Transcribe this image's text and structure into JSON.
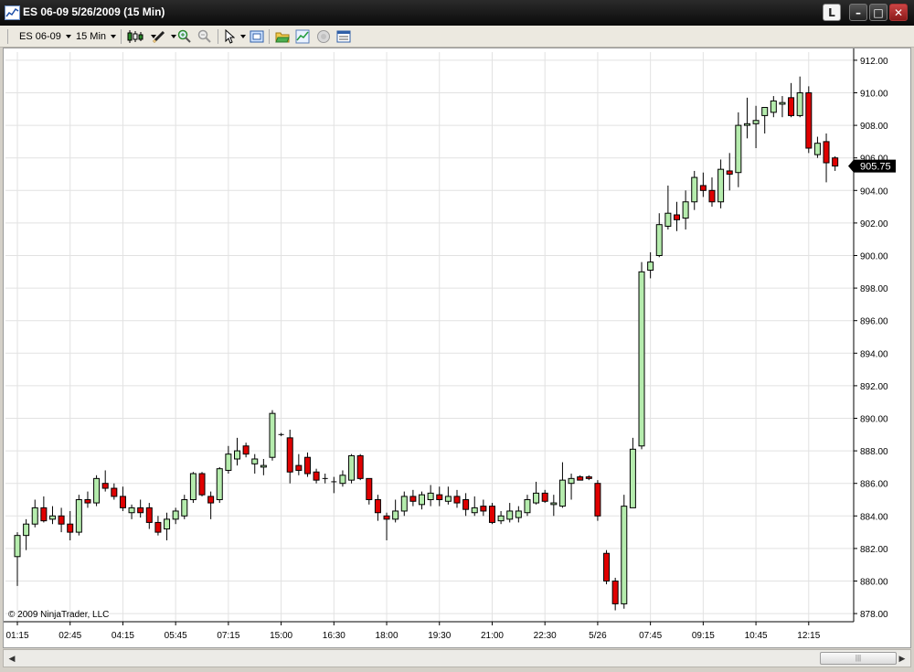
{
  "window": {
    "title": "ES 06-09  5/26/2009 (15 Min)",
    "layout_button": "L",
    "min_glyph": "–",
    "max_glyph": "□",
    "close_glyph": "✕"
  },
  "toolbar": {
    "instrument": "ES 06-09",
    "interval": "15 Min",
    "icons": [
      "candlestick-style-icon",
      "pencil-draw-icon",
      "zoom-in-icon",
      "zoom-out-icon",
      "cursor-icon",
      "snapshot-icon",
      "folder-icon",
      "chart-properties-icon",
      "globe-icon",
      "data-box-icon"
    ]
  },
  "chart": {
    "copyright": "© 2009 NinjaTrader, LLC",
    "last_price_label": "905.75"
  },
  "scrollbar": {
    "left_arrow": "◀",
    "right_arrow": "▶",
    "thumb_grip": "|||"
  },
  "colors": {
    "up": "#b5ecad",
    "down": "#e00000",
    "grid": "#e2e2e2",
    "background": "#ffffff",
    "price_marker": "#000000"
  },
  "chart_data": {
    "type": "candlestick",
    "title": "",
    "xlabel": "",
    "ylabel": "",
    "ylim": [
      877.5,
      912.5
    ],
    "yticks": [
      "912.00",
      "910.00",
      "908.00",
      "906.00",
      "904.00",
      "902.00",
      "900.00",
      "898.00",
      "896.00",
      "894.00",
      "892.00",
      "890.00",
      "888.00",
      "886.00",
      "884.00",
      "882.00",
      "880.00",
      "878.00"
    ],
    "x_tick_labels": [
      "01:15",
      "02:45",
      "04:15",
      "05:45",
      "07:15",
      "15:00",
      "16:30",
      "18:00",
      "19:30",
      "21:00",
      "22:30",
      "5/26",
      "07:45",
      "09:15",
      "10:45",
      "12:15"
    ],
    "grid": true,
    "candles": [
      {
        "o": 881.5,
        "h": 883.0,
        "l": 879.7,
        "c": 882.8
      },
      {
        "o": 882.8,
        "h": 883.8,
        "l": 881.9,
        "c": 883.5
      },
      {
        "o": 883.5,
        "h": 885.0,
        "l": 883.3,
        "c": 884.5
      },
      {
        "o": 884.5,
        "h": 885.2,
        "l": 883.6,
        "c": 883.7
      },
      {
        "o": 883.8,
        "h": 884.6,
        "l": 883.5,
        "c": 884.0
      },
      {
        "o": 884.0,
        "h": 884.5,
        "l": 883.0,
        "c": 883.5
      },
      {
        "o": 883.5,
        "h": 884.3,
        "l": 882.5,
        "c": 883.0
      },
      {
        "o": 883.0,
        "h": 885.3,
        "l": 882.8,
        "c": 885.0
      },
      {
        "o": 885.0,
        "h": 885.5,
        "l": 884.5,
        "c": 884.8
      },
      {
        "o": 884.8,
        "h": 886.5,
        "l": 884.6,
        "c": 886.3
      },
      {
        "o": 886.0,
        "h": 886.8,
        "l": 885.5,
        "c": 885.7
      },
      {
        "o": 885.7,
        "h": 886.0,
        "l": 885.0,
        "c": 885.2
      },
      {
        "o": 885.2,
        "h": 885.8,
        "l": 884.3,
        "c": 884.5
      },
      {
        "o": 884.2,
        "h": 884.7,
        "l": 883.8,
        "c": 884.5
      },
      {
        "o": 884.5,
        "h": 885.0,
        "l": 883.9,
        "c": 884.2
      },
      {
        "o": 884.5,
        "h": 884.8,
        "l": 883.2,
        "c": 883.6
      },
      {
        "o": 883.6,
        "h": 884.0,
        "l": 882.8,
        "c": 883.0
      },
      {
        "o": 883.2,
        "h": 884.2,
        "l": 882.5,
        "c": 883.8
      },
      {
        "o": 883.8,
        "h": 884.5,
        "l": 883.5,
        "c": 884.3
      },
      {
        "o": 884.0,
        "h": 885.3,
        "l": 883.8,
        "c": 885.0
      },
      {
        "o": 885.0,
        "h": 886.7,
        "l": 884.8,
        "c": 886.6
      },
      {
        "o": 886.6,
        "h": 886.7,
        "l": 885.2,
        "c": 885.3
      },
      {
        "o": 885.2,
        "h": 885.5,
        "l": 883.8,
        "c": 884.8
      },
      {
        "o": 885.0,
        "h": 887.0,
        "l": 884.8,
        "c": 886.9
      },
      {
        "o": 886.8,
        "h": 888.3,
        "l": 886.6,
        "c": 887.8
      },
      {
        "o": 887.5,
        "h": 888.8,
        "l": 887.1,
        "c": 888.0
      },
      {
        "o": 888.3,
        "h": 888.5,
        "l": 887.6,
        "c": 887.8
      },
      {
        "o": 887.2,
        "h": 887.8,
        "l": 886.6,
        "c": 887.5
      },
      {
        "o": 887.0,
        "h": 887.5,
        "l": 886.5,
        "c": 887.1
      },
      {
        "o": 887.6,
        "h": 890.5,
        "l": 887.4,
        "c": 890.3
      },
      {
        "o": 889.0,
        "h": 889.1,
        "l": 888.9,
        "c": 889.0
      },
      {
        "o": 888.8,
        "h": 889.3,
        "l": 886.0,
        "c": 886.7
      },
      {
        "o": 887.1,
        "h": 887.8,
        "l": 886.5,
        "c": 886.8
      },
      {
        "o": 887.6,
        "h": 887.9,
        "l": 886.4,
        "c": 886.6
      },
      {
        "o": 886.7,
        "h": 886.9,
        "l": 886.0,
        "c": 886.2
      },
      {
        "o": 886.3,
        "h": 886.6,
        "l": 886.0,
        "c": 886.3
      },
      {
        "o": 886.1,
        "h": 886.4,
        "l": 885.4,
        "c": 886.1
      },
      {
        "o": 886.0,
        "h": 886.8,
        "l": 885.8,
        "c": 886.5
      },
      {
        "o": 886.2,
        "h": 887.8,
        "l": 886.0,
        "c": 887.7
      },
      {
        "o": 887.7,
        "h": 887.8,
        "l": 886.2,
        "c": 886.3
      },
      {
        "o": 886.3,
        "h": 886.3,
        "l": 884.7,
        "c": 885.0
      },
      {
        "o": 885.0,
        "h": 885.3,
        "l": 883.7,
        "c": 884.2
      },
      {
        "o": 884.0,
        "h": 884.2,
        "l": 882.5,
        "c": 883.8
      },
      {
        "o": 883.8,
        "h": 885.0,
        "l": 883.6,
        "c": 884.3
      },
      {
        "o": 884.3,
        "h": 885.5,
        "l": 884.0,
        "c": 885.2
      },
      {
        "o": 885.2,
        "h": 885.6,
        "l": 884.6,
        "c": 884.9
      },
      {
        "o": 884.7,
        "h": 885.5,
        "l": 884.4,
        "c": 885.3
      },
      {
        "o": 885.0,
        "h": 885.9,
        "l": 884.6,
        "c": 885.4
      },
      {
        "o": 885.3,
        "h": 885.8,
        "l": 884.6,
        "c": 885.0
      },
      {
        "o": 884.9,
        "h": 885.8,
        "l": 884.7,
        "c": 885.2
      },
      {
        "o": 885.2,
        "h": 885.6,
        "l": 884.5,
        "c": 884.8
      },
      {
        "o": 885.0,
        "h": 885.4,
        "l": 884.0,
        "c": 884.4
      },
      {
        "o": 884.2,
        "h": 885.2,
        "l": 884.0,
        "c": 884.5
      },
      {
        "o": 884.6,
        "h": 885.0,
        "l": 884.0,
        "c": 884.3
      },
      {
        "o": 884.6,
        "h": 884.8,
        "l": 883.5,
        "c": 883.6
      },
      {
        "o": 883.7,
        "h": 884.3,
        "l": 883.5,
        "c": 884.0
      },
      {
        "o": 883.8,
        "h": 884.8,
        "l": 883.6,
        "c": 884.3
      },
      {
        "o": 883.9,
        "h": 884.6,
        "l": 883.6,
        "c": 884.3
      },
      {
        "o": 884.2,
        "h": 885.3,
        "l": 884.0,
        "c": 885.0
      },
      {
        "o": 884.8,
        "h": 886.1,
        "l": 884.7,
        "c": 885.4
      },
      {
        "o": 885.4,
        "h": 885.6,
        "l": 884.8,
        "c": 884.9
      },
      {
        "o": 884.7,
        "h": 885.3,
        "l": 884.0,
        "c": 884.8
      },
      {
        "o": 884.6,
        "h": 887.3,
        "l": 884.5,
        "c": 886.2
      },
      {
        "o": 886.0,
        "h": 886.6,
        "l": 885.0,
        "c": 886.3
      },
      {
        "o": 886.4,
        "h": 886.5,
        "l": 886.2,
        "c": 886.2
      },
      {
        "o": 886.4,
        "h": 886.5,
        "l": 886.2,
        "c": 886.3
      },
      {
        "o": 886.0,
        "h": 886.2,
        "l": 883.7,
        "c": 884.0
      },
      {
        "o": 881.7,
        "h": 881.9,
        "l": 879.8,
        "c": 880.0
      },
      {
        "o": 880.0,
        "h": 880.2,
        "l": 878.2,
        "c": 878.6
      },
      {
        "o": 878.6,
        "h": 885.3,
        "l": 878.3,
        "c": 884.6
      },
      {
        "o": 884.5,
        "h": 888.8,
        "l": 884.5,
        "c": 888.1
      },
      {
        "o": 888.3,
        "h": 899.6,
        "l": 888.1,
        "c": 899.0
      },
      {
        "o": 899.1,
        "h": 900.2,
        "l": 898.6,
        "c": 899.6
      },
      {
        "o": 900.0,
        "h": 902.6,
        "l": 899.9,
        "c": 901.9
      },
      {
        "o": 901.8,
        "h": 904.3,
        "l": 901.6,
        "c": 902.6
      },
      {
        "o": 902.5,
        "h": 903.3,
        "l": 901.5,
        "c": 902.2
      },
      {
        "o": 902.3,
        "h": 904.0,
        "l": 901.6,
        "c": 903.3
      },
      {
        "o": 903.3,
        "h": 905.2,
        "l": 902.8,
        "c": 904.8
      },
      {
        "o": 904.3,
        "h": 905.1,
        "l": 903.6,
        "c": 904.0
      },
      {
        "o": 904.0,
        "h": 904.8,
        "l": 903.0,
        "c": 903.3
      },
      {
        "o": 903.3,
        "h": 905.9,
        "l": 902.9,
        "c": 905.3
      },
      {
        "o": 905.2,
        "h": 906.3,
        "l": 904.0,
        "c": 905.0
      },
      {
        "o": 905.1,
        "h": 908.8,
        "l": 904.2,
        "c": 908.0
      },
      {
        "o": 908.0,
        "h": 909.7,
        "l": 907.2,
        "c": 908.1
      },
      {
        "o": 908.1,
        "h": 909.2,
        "l": 906.6,
        "c": 908.3
      },
      {
        "o": 908.6,
        "h": 909.0,
        "l": 907.5,
        "c": 909.1
      },
      {
        "o": 908.8,
        "h": 909.8,
        "l": 908.5,
        "c": 909.5
      },
      {
        "o": 909.3,
        "h": 909.8,
        "l": 908.5,
        "c": 909.4
      },
      {
        "o": 909.7,
        "h": 910.6,
        "l": 908.5,
        "c": 908.6
      },
      {
        "o": 908.6,
        "h": 911.0,
        "l": 908.5,
        "c": 910.0
      },
      {
        "o": 910.0,
        "h": 910.4,
        "l": 906.3,
        "c": 906.6
      },
      {
        "o": 906.2,
        "h": 907.3,
        "l": 906.0,
        "c": 906.9
      },
      {
        "o": 907.0,
        "h": 907.5,
        "l": 904.5,
        "c": 905.7
      },
      {
        "o": 906.0,
        "h": 906.1,
        "l": 905.2,
        "c": 905.5
      }
    ]
  }
}
